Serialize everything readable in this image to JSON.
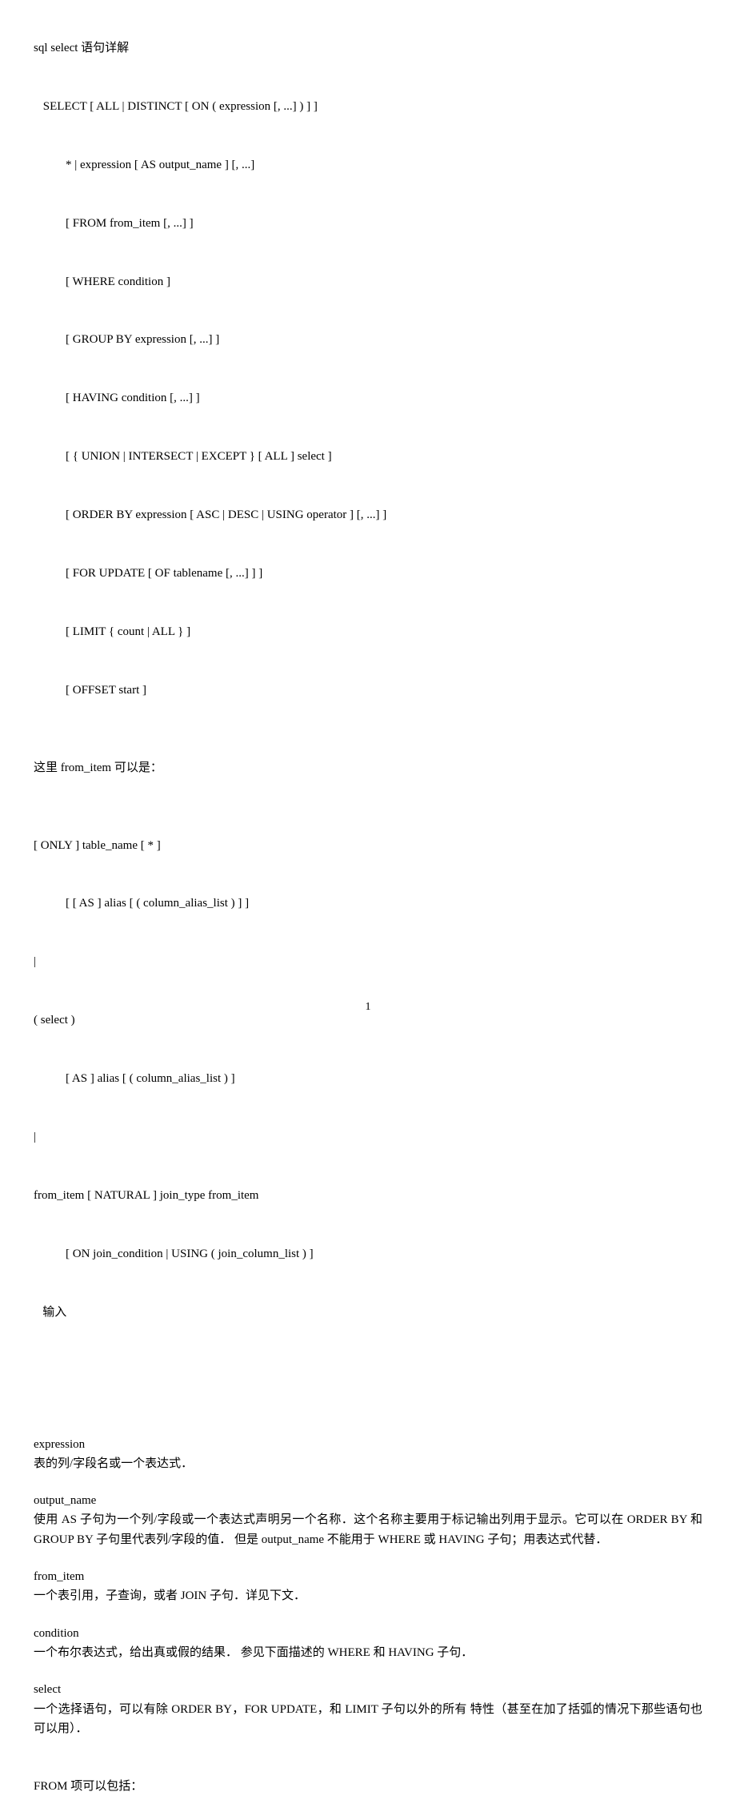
{
  "title": "sql select 语句详解",
  "syntax": {
    "l1": " SELECT [ ALL | DISTINCT [ ON ( expression [, ...] ) ] ]",
    "l2": "* | expression [ AS output_name ] [, ...]",
    "l3": "[ FROM from_item [, ...] ]",
    "l4": "[ WHERE condition ]",
    "l5": "[ GROUP BY expression [, ...] ]",
    "l6": "[ HAVING condition [, ...] ]",
    "l7": "[ { UNION | INTERSECT | EXCEPT } [ ALL ] select ]",
    "l8": "[ ORDER BY expression [ ASC | DESC | USING operator ] [, ...] ]",
    "l9": "[ FOR UPDATE [ OF tablename [, ...] ] ]",
    "l10": "[ LIMIT { count | ALL } ]",
    "l11": "[ OFFSET start ]"
  },
  "from_intro": "这里  from_item  可以是：",
  "from_syntax": {
    "f1": "[ ONLY ] table_name [ * ]",
    "f2": "[ [ AS ] alias [ ( column_alias_list ) ] ]",
    "f3": "|",
    "f4": "( select )",
    "f5": "[ AS ] alias [ ( column_alias_list ) ]",
    "f6": "|",
    "f7": "from_item [ NATURAL ] join_type from_item",
    "f8": "[ ON join_condition | USING ( join_column_list ) ]",
    "f9": "   输入"
  },
  "terms": {
    "expression": {
      "name": "expression",
      "desc": "表的列/字段名或一个表达式．"
    },
    "output_name": {
      "name": "output_name",
      "desc": "使用 AS 子句为一个列/字段或一个表达式声明另一个名称．这个名称主要用于标记输出列用于显示。它可以在 ORDER BY  和  GROUP BY  子句里代表列/字段的值．   但是  output_name  不能用于  WHERE  或  HAVING  子句；用表达式代替．"
    },
    "from_item": {
      "name": "from_item",
      "desc": "一个表引用，子查询，或者  JOIN  子句．详见下文．"
    },
    "condition": {
      "name": "condition",
      "desc": "一个布尔表达式，给出真或假的结果．   参见下面描述的  WHERE  和  HAVING  子句．"
    },
    "select": {
      "name": "select",
      "desc": "一个选择语句，可以有除  ORDER BY，FOR UPDATE，和  LIMIT  子句以外的所有  特性（甚至在加了括弧的情况下那些语句也可以用）．"
    }
  },
  "from_include": "FROM  项可以包括：",
  "page_number": "1"
}
